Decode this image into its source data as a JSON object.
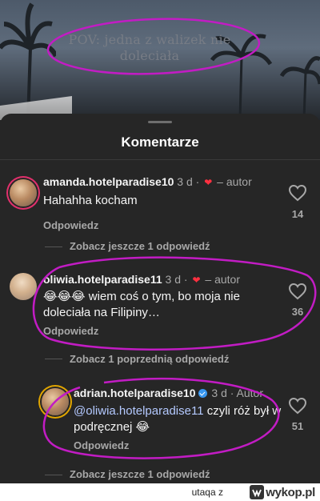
{
  "video": {
    "overlay_text": "POV: jedna z walizek nie doleciała"
  },
  "sheet": {
    "title": "Komentarze"
  },
  "comments": [
    {
      "username": "amanda.hotelparadise10",
      "time": "3 d",
      "author_tag": "– autor",
      "text": "Hahahha kocham",
      "reply_label": "Odpowiedz",
      "likes": "14",
      "more_replies": "Zobacz jeszcze 1 odpowiedź"
    },
    {
      "username": "oliwia.hotelparadise11",
      "time": "3 d",
      "author_tag": "– autor",
      "text": "😂😂😂 wiem coś o tym, bo moja nie doleciała na Filipiny…",
      "reply_label": "Odpowiedz",
      "likes": "36",
      "more_replies": "Zobacz 1 poprzednią odpowiedź"
    },
    {
      "username": "adrian.hotelparadise10",
      "time": "3 d",
      "author_tag": "Autor",
      "mention": "@oliwia.hotelparadise11",
      "text": " czyli róż był w podręcznej 😂",
      "reply_label": "Odpowiedz",
      "likes": "51",
      "more_replies": "Zobacz jeszcze 1 odpowiedź"
    }
  ],
  "footer": {
    "user": "utaqa z",
    "brand": "wykop.pl"
  },
  "colors": {
    "sheet_bg": "#262626",
    "annotation": "#c21cc4",
    "heart": "#ff3040",
    "mention": "#b4c9ff"
  }
}
